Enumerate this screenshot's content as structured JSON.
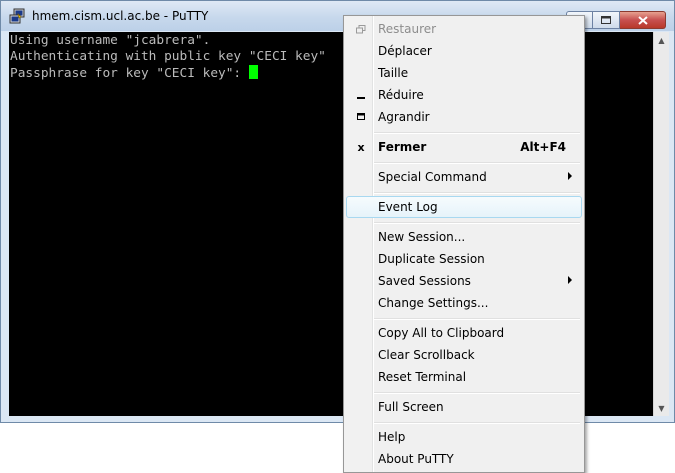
{
  "window": {
    "title": "hmem.cism.ucl.ac.be - PuTTY",
    "icon": "putty-icon"
  },
  "terminal": {
    "lines": [
      "Using username \"jcabrera\".",
      "Authenticating with public key \"CECI key\"",
      "Passphrase for key \"CECI key\": "
    ],
    "cursor_color": "#00ff00"
  },
  "menu": {
    "items": [
      {
        "label": "Restaurer",
        "icon": "restore-icon",
        "disabled": true
      },
      {
        "label": "Déplacer"
      },
      {
        "label": "Taille"
      },
      {
        "label": "Réduire",
        "icon": "minimize-icon"
      },
      {
        "label": "Agrandir",
        "icon": "maximize-icon"
      },
      {
        "label": "Fermer",
        "accel": "Alt+F4",
        "icon": "close-icon",
        "bold": true
      },
      {
        "label": "Special Command",
        "submenu": true
      },
      {
        "label": "Event Log",
        "highlighted": true
      },
      {
        "label": "New Session..."
      },
      {
        "label": "Duplicate Session"
      },
      {
        "label": "Saved Sessions",
        "submenu": true
      },
      {
        "label": "Change Settings..."
      },
      {
        "label": "Copy All to Clipboard"
      },
      {
        "label": "Clear Scrollback"
      },
      {
        "label": "Reset Terminal"
      },
      {
        "label": "Full Screen"
      },
      {
        "label": "Help"
      },
      {
        "label": "About PuTTY"
      }
    ]
  }
}
